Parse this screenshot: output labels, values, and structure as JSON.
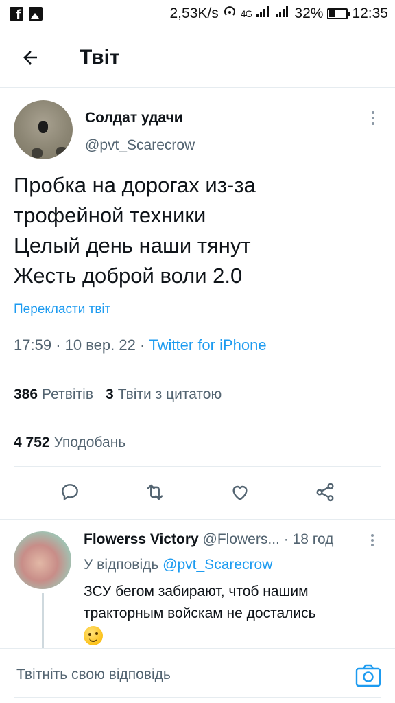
{
  "status_bar": {
    "speed": "2,53K/s",
    "network": "4G",
    "battery": "32%",
    "time": "12:35"
  },
  "header": {
    "title": "Твіт"
  },
  "tweet": {
    "author_name": "Солдат удачи",
    "author_handle": "@pvt_Scarecrow",
    "text_lines": [
      "Пробка на дорогах из-за",
      "трофейной техники",
      "Целый день наши тянут",
      "Жесть доброй воли 2.0"
    ],
    "translate_label": "Перекласти твіт",
    "time": "17:59",
    "date": "10 вер. 22",
    "source": "Twitter for iPhone",
    "retweets_count": "386",
    "retweets_label": "Ретвітів",
    "quotes_count": "3",
    "quotes_label": "Твіти з цитатою",
    "likes_count": "4 752",
    "likes_label": "Уподобань"
  },
  "reply": {
    "author_name": "Flowerss Victory",
    "author_handle": "@Flowers...",
    "age": "18 год",
    "reply_prefix": "У відповідь",
    "reply_to": "@pvt_Scarecrow",
    "text_line1": "ЗСУ бегом забирают, чтоб нашим",
    "text_line2": "тракторным войскам не достались"
  },
  "compose": {
    "placeholder": "Твітніть свою відповідь"
  },
  "colors": {
    "accent": "#1d9bf0",
    "secondary_text": "#536471",
    "divider": "#e6ecf0"
  }
}
